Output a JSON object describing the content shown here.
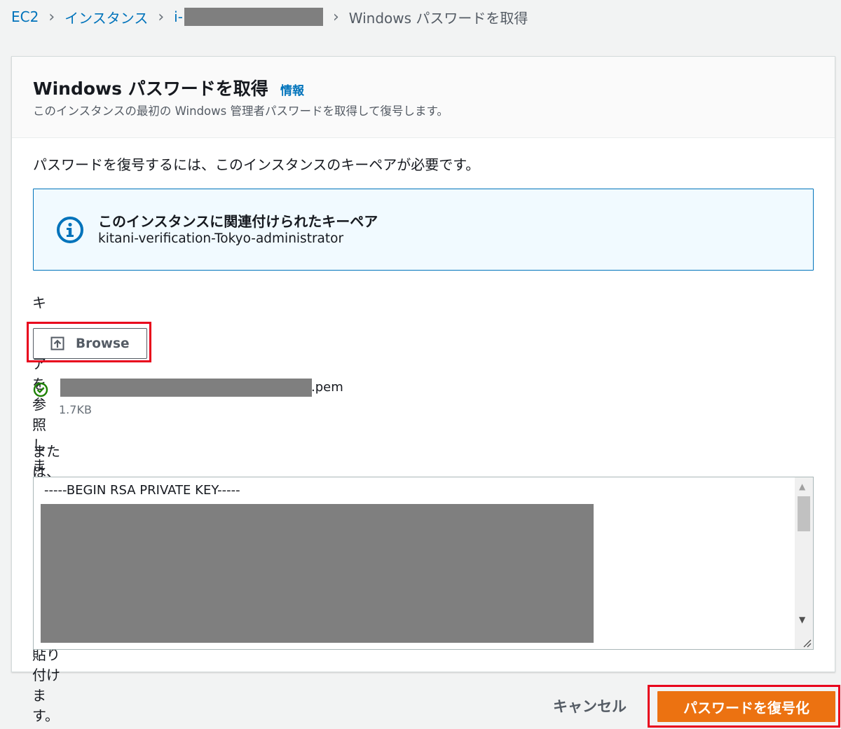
{
  "breadcrumb": {
    "items": [
      "EC2",
      "インスタンス",
      "i-"
    ],
    "current": "Windows パスワードを取得"
  },
  "header": {
    "title": "Windows パスワードを取得",
    "info_link": "情報",
    "description": "このインスタンスの最初の Windows 管理者パスワードを取得して復号します。"
  },
  "intro_text": "パスワードを復号するには、このインスタンスのキーペアが必要です。",
  "alert": {
    "title": "このインスタンスに関連付けられたキーペア",
    "key_pair_name": "kitani-verification-Tokyo-administrator"
  },
  "browse": {
    "label": "キーペアを参照します。",
    "button_label": "Browse"
  },
  "selected_file": {
    "extension": ".pem",
    "size": "1.7KB"
  },
  "paste": {
    "label": "または、以下のキーペアの内容をコピーして貼り付けます。",
    "content_first_line": "-----BEGIN RSA PRIVATE KEY-----"
  },
  "footer": {
    "cancel_label": "キャンセル",
    "decrypt_label": "パスワードを復号化"
  },
  "colors": {
    "link": "#0073bb",
    "primary": "#ec7211",
    "highlight": "#e8001c",
    "success": "#1d8102"
  }
}
